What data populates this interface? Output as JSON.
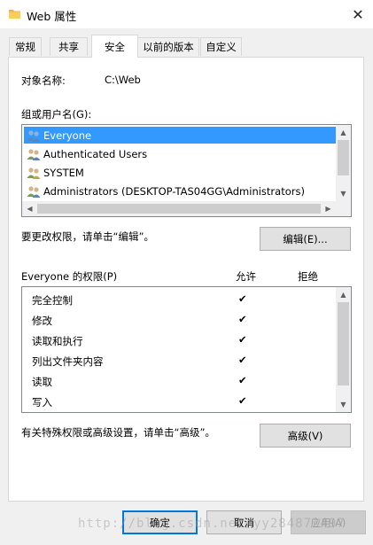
{
  "window": {
    "title": "Web 属性",
    "close_label": "✕"
  },
  "tabs": [
    {
      "label": "常规"
    },
    {
      "label": "共享"
    },
    {
      "label": "安全",
      "active": true
    },
    {
      "label": "以前的版本"
    },
    {
      "label": "自定义"
    }
  ],
  "object": {
    "label": "对象名称:",
    "value": "C:\\Web"
  },
  "groups": {
    "label": "组或用户名(G):",
    "users": [
      {
        "name": "Everyone",
        "selected": true
      },
      {
        "name": "Authenticated Users"
      },
      {
        "name": "SYSTEM"
      },
      {
        "name": "Administrators (DESKTOP-TAS04GG\\Administrators)"
      }
    ]
  },
  "edit": {
    "hint": "要更改权限，请单击“编辑”。",
    "button": "编辑(E)..."
  },
  "permissions": {
    "label": "Everyone 的权限(P)",
    "allow_header": "允许",
    "deny_header": "拒绝",
    "rows": [
      {
        "name": "完全控制",
        "allow": true,
        "deny": false
      },
      {
        "name": "修改",
        "allow": true,
        "deny": false
      },
      {
        "name": "读取和执行",
        "allow": true,
        "deny": false
      },
      {
        "name": "列出文件夹内容",
        "allow": true,
        "deny": false
      },
      {
        "name": "读取",
        "allow": true,
        "deny": false
      },
      {
        "name": "写入",
        "allow": true,
        "deny": false
      }
    ],
    "check_glyph": "✔"
  },
  "advanced": {
    "hint": "有关特殊权限或高级设置，请单击“高级”。",
    "button": "高级(V)"
  },
  "footer": {
    "ok": "确定",
    "cancel": "取消",
    "apply": "应用(A)"
  },
  "watermark": "http://blog.csdn.net/yy284872497",
  "colors": {
    "selection": "#3399ff",
    "accent": "#0078d7"
  }
}
